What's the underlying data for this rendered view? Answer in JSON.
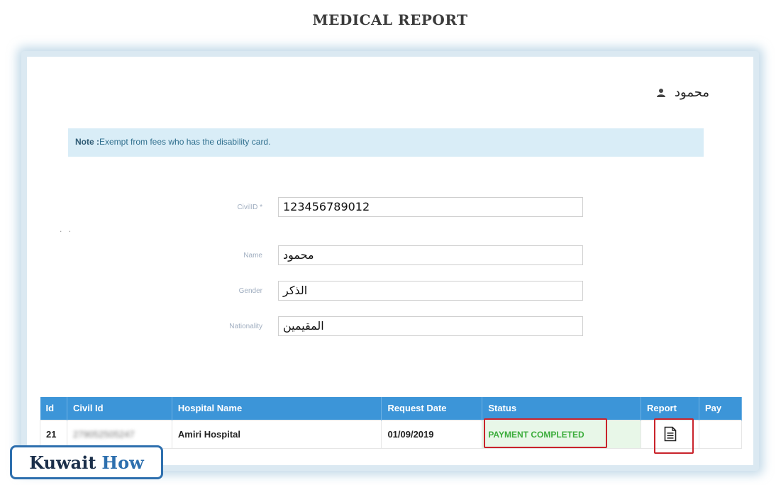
{
  "page": {
    "title": "MEDICAL REPORT"
  },
  "user": {
    "name": "محمود",
    "icon": "user-icon"
  },
  "note": {
    "label": "Note :",
    "text": "Exempt from fees who has the disability card."
  },
  "decor": {
    "dots": ". ."
  },
  "form": {
    "civil_id": {
      "label": "CivilID *",
      "value": "123456789012"
    },
    "name": {
      "label": "Name",
      "value": "محمود"
    },
    "gender": {
      "label": "Gender",
      "value": "الذكر"
    },
    "nationality": {
      "label": "Nationality",
      "value": "المقيمين"
    }
  },
  "table": {
    "headers": [
      "Id",
      "Civil Id",
      "Hospital Name",
      "Request Date",
      "Status",
      "Report",
      "Pay"
    ],
    "rows": [
      {
        "id": "21",
        "civil_id": "279052505247",
        "hospital": "Amiri Hospital",
        "request_date": "01/09/2019",
        "status": "PAYMENT COMPLETED",
        "report_icon": "document-icon",
        "pay": ""
      }
    ]
  },
  "colors": {
    "header": "#3c95d8",
    "status": "#3cad3c",
    "highlight": "#c9232b",
    "note_bg": "#d9edf7"
  },
  "watermark": {
    "part1": "Kuwait",
    "part2": "How"
  }
}
